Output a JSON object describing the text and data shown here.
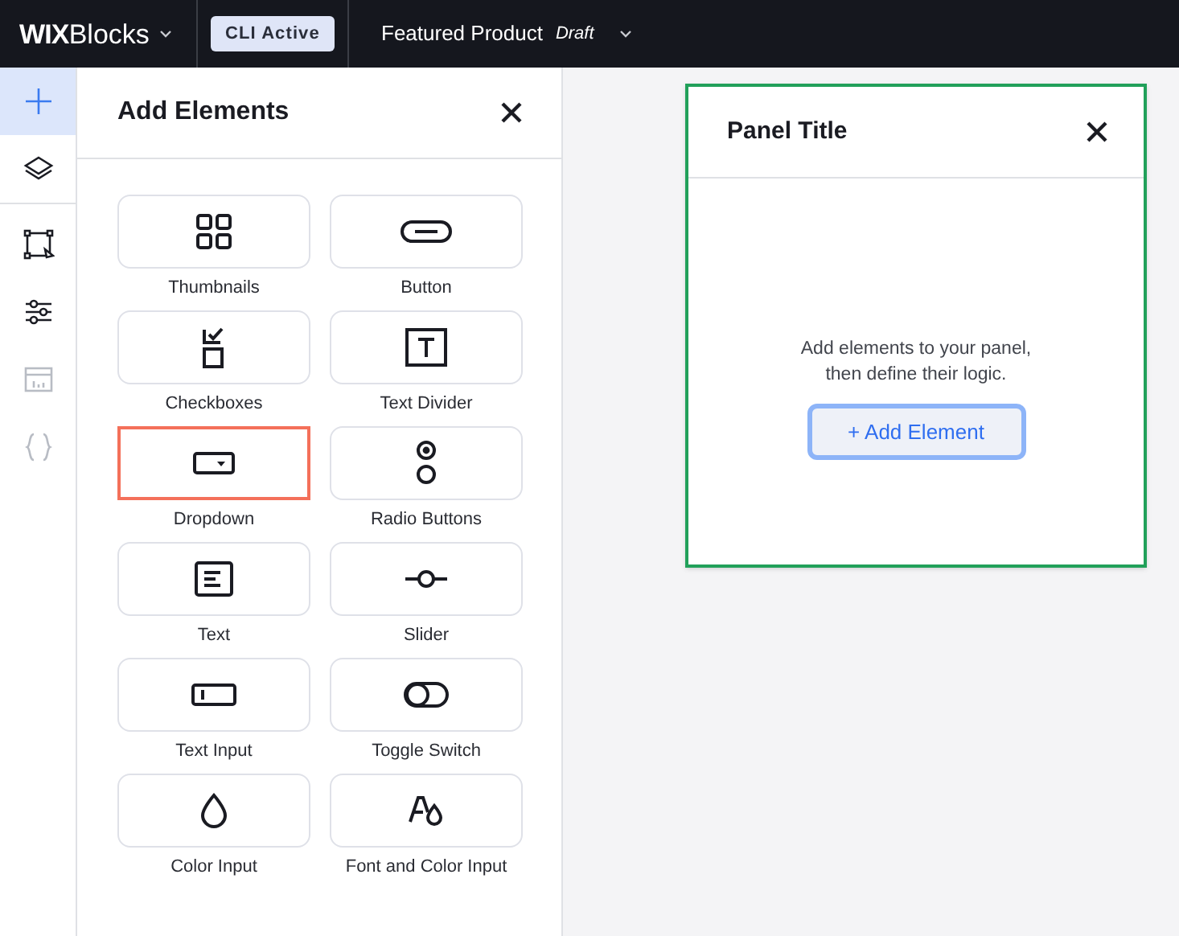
{
  "top_bar": {
    "logo": {
      "brand": "WIX",
      "product": "Blocks"
    },
    "badge": "CLI Active",
    "project": {
      "name": "Featured Product",
      "status": "Draft"
    }
  },
  "rail": {
    "groups": [
      [
        {
          "kind": "plus",
          "selected": true,
          "disabled": false
        },
        {
          "kind": "layers",
          "selected": false,
          "disabled": false
        }
      ],
      [
        {
          "kind": "frame",
          "selected": false,
          "disabled": false
        },
        {
          "kind": "sliders",
          "selected": false,
          "disabled": false
        },
        {
          "kind": "table",
          "selected": false,
          "disabled": true
        },
        {
          "kind": "braces",
          "selected": false,
          "disabled": true
        }
      ]
    ]
  },
  "add_panel": {
    "title": "Add Elements",
    "elements": [
      {
        "kind": "thumbnails",
        "label": "Thumbnails",
        "selected": false
      },
      {
        "kind": "button",
        "label": "Button",
        "selected": false
      },
      {
        "kind": "checkboxes",
        "label": "Checkboxes",
        "selected": false
      },
      {
        "kind": "text_divider",
        "label": "Text Divider",
        "selected": false
      },
      {
        "kind": "dropdown",
        "label": "Dropdown",
        "selected": true
      },
      {
        "kind": "radio",
        "label": "Radio Buttons",
        "selected": false
      },
      {
        "kind": "text",
        "label": "Text",
        "selected": false
      },
      {
        "kind": "slider",
        "label": "Slider",
        "selected": false
      },
      {
        "kind": "text_input",
        "label": "Text Input",
        "selected": false
      },
      {
        "kind": "toggle",
        "label": "Toggle Switch",
        "selected": false
      },
      {
        "kind": "color_input",
        "label": "Color Input",
        "selected": false
      },
      {
        "kind": "font_color_input",
        "label": "Font and Color Input",
        "selected": false
      }
    ]
  },
  "canvas": {
    "panel": {
      "title": "Panel Title",
      "message": "Add elements to your panel,\nthen define their logic.",
      "button": "+ Add Element"
    }
  }
}
